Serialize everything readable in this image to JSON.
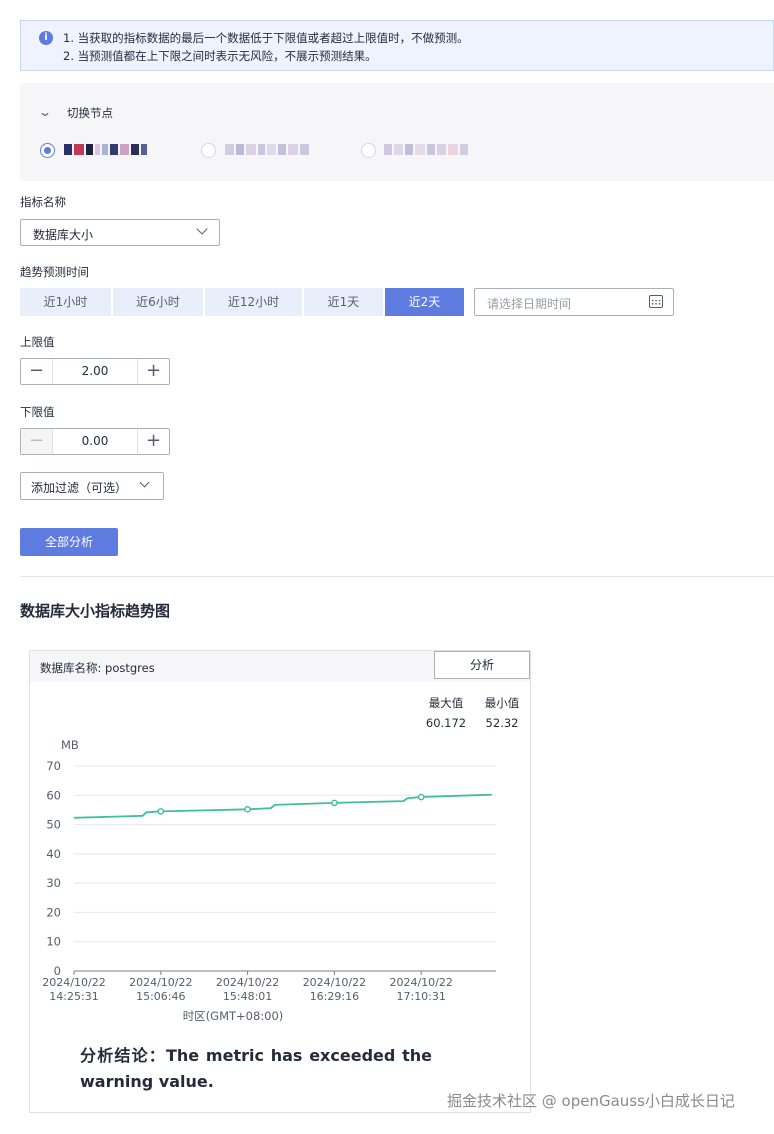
{
  "notice": {
    "line1": "1.  当获取的指标数据的最后一个数据低于下限值或者超过上限值时，不做预测。",
    "line2": "2.  当预测值都在上下限之间时表示无风险，不展示预测结果。"
  },
  "node_panel": {
    "title": "切换节点"
  },
  "metric": {
    "label": "指标名称",
    "selected": "数据库大小"
  },
  "trend": {
    "label": "趋势预测时间",
    "options": [
      "近1小时",
      "近6小时",
      "近12小时",
      "近1天",
      "近2天"
    ],
    "active_index": 4,
    "date_placeholder": "请选择日期时间"
  },
  "upper": {
    "label": "上限值",
    "value": "2.00"
  },
  "lower": {
    "label": "下限值",
    "value": "0.00"
  },
  "filter": {
    "value": "添加过滤（可选）"
  },
  "analyze_all": "全部分析",
  "section_title": "数据库大小指标趋势图",
  "card": {
    "db_name": "数据库名称:  postgres",
    "analyze_button": "分析",
    "max_label": "最大值",
    "min_label": "最小值",
    "max_value": "60.172",
    "min_value": "52.32",
    "conclusion": "分析结论：The metric has exceeded the warning value."
  },
  "chart_data": {
    "type": "line",
    "ylabel": "MB",
    "xlabel": "时区(GMT+08:00)",
    "ylim": [
      0,
      70
    ],
    "yticks": [
      0,
      10,
      20,
      30,
      40,
      50,
      60,
      70
    ],
    "xticks": [
      [
        "2024/10/22",
        "14:25:31"
      ],
      [
        "2024/10/22",
        "15:06:46"
      ],
      [
        "2024/10/22",
        "15:48:01"
      ],
      [
        "2024/10/22",
        "16:29:16"
      ],
      [
        "2024/10/22",
        "17:10:31"
      ]
    ],
    "grid": true,
    "color": "#3fbf9a",
    "series": [
      {
        "x": [
          "14:25:31",
          "14:58:00",
          "15:00:00",
          "15:06:46",
          "15:48:01",
          "15:59:00",
          "16:01:00",
          "16:29:16",
          "17:02:00",
          "17:04:00",
          "17:10:31",
          "17:44:00"
        ],
        "values": [
          52.3,
          53.0,
          54.2,
          54.5,
          55.2,
          55.6,
          56.7,
          57.4,
          58.0,
          59.0,
          59.4,
          60.2
        ],
        "markers": [
          "15:06:46",
          "15:48:01",
          "16:29:16",
          "17:10:31"
        ]
      }
    ]
  },
  "watermark": "掘金技术社区 @ openGauss小白成长日记",
  "colors": {
    "accent": "#5e7ce0",
    "line": "#3fbf9a"
  }
}
